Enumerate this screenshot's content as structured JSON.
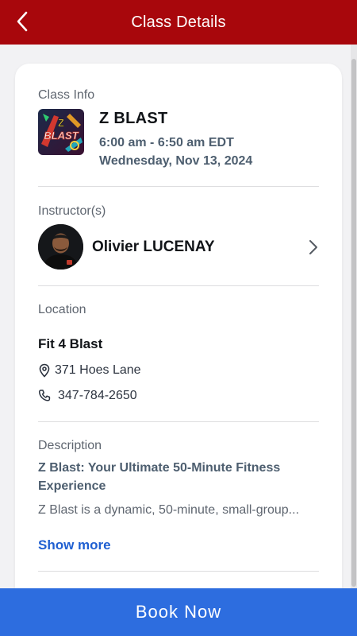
{
  "header": {
    "title": "Class Details",
    "back_icon": "chevron-left-icon",
    "background_color": "#a8070c"
  },
  "class_info": {
    "section_label": "Class Info",
    "logo_text": "Z BLAST",
    "name": "Z BLAST",
    "time": "6:00 am - 6:50 am EDT",
    "date": "Wednesday, Nov 13, 2024"
  },
  "instructor": {
    "section_label": "Instructor(s)",
    "name": "Olivier LUCENAY",
    "icon": "chevron-right-icon"
  },
  "location": {
    "section_label": "Location",
    "name": "Fit 4 Blast",
    "address": "371 Hoes Lane",
    "address_icon": "map-pin-icon",
    "phone": "347-784-2650",
    "phone_icon": "phone-icon"
  },
  "description": {
    "section_label": "Description",
    "title": "Z Blast: Your Ultimate 50-Minute Fitness Experience",
    "body": "Z Blast is a dynamic, 50-minute, small-group...",
    "show_more_label": "Show more"
  },
  "footer": {
    "book_label": "Book Now",
    "button_color": "#2d6ddf"
  }
}
